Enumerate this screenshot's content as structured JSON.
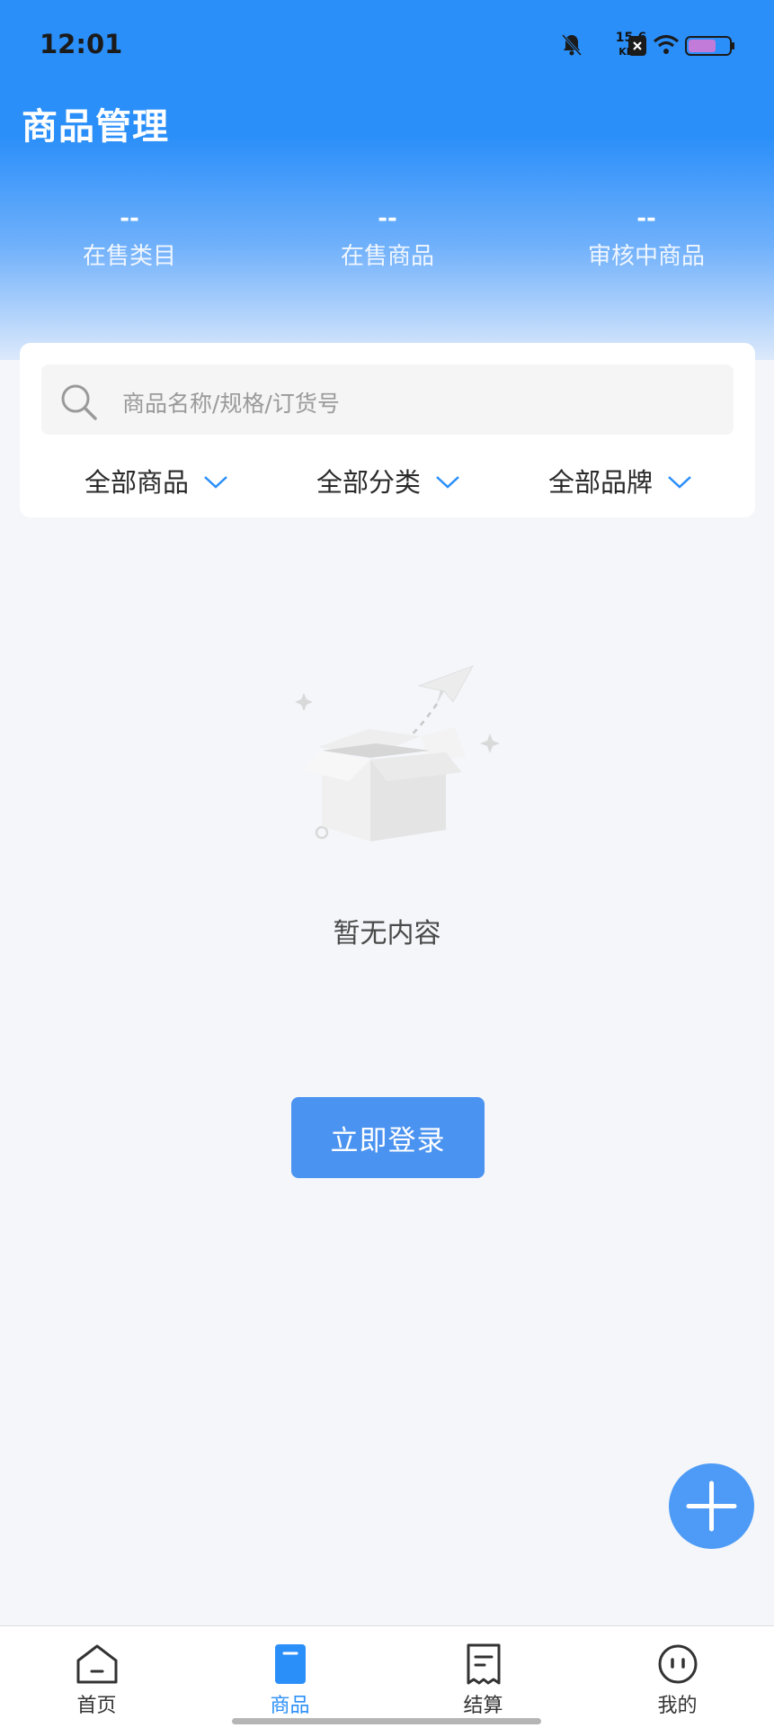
{
  "status_bar": {
    "time": "12:01",
    "net_speed": "15.6",
    "net_unit": "KB/s",
    "icons": [
      "bell-off-icon",
      "x-badge-icon",
      "wifi-icon",
      "battery-icon"
    ]
  },
  "header": {
    "title": "商品管理"
  },
  "stats": [
    {
      "value": "--",
      "label": "在售类目"
    },
    {
      "value": "--",
      "label": "在售商品"
    },
    {
      "value": "--",
      "label": "审核中商品"
    }
  ],
  "search": {
    "placeholder": "商品名称/规格/订货号"
  },
  "filters": [
    {
      "label": "全部商品"
    },
    {
      "label": "全部分类"
    },
    {
      "label": "全部品牌"
    }
  ],
  "empty_state": {
    "text": "暂无内容"
  },
  "login_button": {
    "label": "立即登录"
  },
  "tabbar": {
    "active": "商品",
    "items": [
      {
        "label": "首页",
        "icon": "home-icon"
      },
      {
        "label": "商品",
        "icon": "goods-icon"
      },
      {
        "label": "结算",
        "icon": "receipt-icon"
      },
      {
        "label": "我的",
        "icon": "profile-icon"
      }
    ]
  },
  "colors": {
    "primary": "#2b8ff9",
    "button": "#4b93f0",
    "background": "#f4f6fa"
  }
}
